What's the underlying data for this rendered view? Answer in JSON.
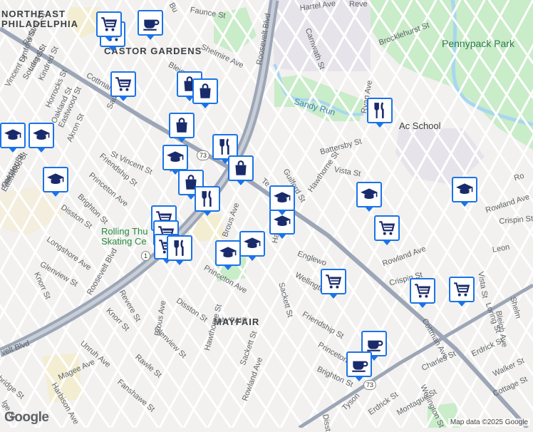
{
  "map": {
    "colors": {
      "land": "#f2f1ef",
      "park": "#c9ecc9",
      "water": "#a8d7f0",
      "highway": "#9ca6b6",
      "road": "#ffffff",
      "pin_border": "#1a73e8",
      "mall": "#f3edd2",
      "grey_zone": "#e6e4ea"
    },
    "area_labels": [
      {
        "id": "northeast",
        "text": "NORTHEAST"
      },
      {
        "id": "philadelphia",
        "text": "PHILADELPHIA"
      },
      {
        "id": "castor-gardens",
        "text": "CASTOR GARDENS"
      },
      {
        "id": "mayfair",
        "text": "MAYFAIR"
      }
    ],
    "park_labels": [
      {
        "id": "pennypack",
        "text": "Pennypack Park"
      }
    ],
    "water_labels": [
      {
        "id": "sandy-run",
        "text": "Sandy Run"
      }
    ],
    "poi_labels": [
      {
        "id": "rolling-1",
        "text": "Rolling Thu"
      },
      {
        "id": "rolling-2",
        "text": "Skating Ce"
      },
      {
        "id": "school",
        "text": "Ac     School"
      }
    ],
    "street_labels": [
      "Hartel Ave",
      "Reve",
      "Carnwath St",
      "Brocklehurst St",
      "Bu",
      "Faunce St",
      "Shelmire Ave",
      "Roosevelt Blvd",
      "Ryan Ave",
      "Battersby St",
      "Vista St",
      "Guilford St",
      "Hawthorne St",
      "Te",
      "Rowland Ave",
      "Rowland Ave",
      "Ro",
      "Crispin St",
      "Leon",
      "Crispin St",
      "Vista St",
      "Loring St",
      "Bleigh Ave",
      "Shelm",
      "Erdrick St",
      "Walker St",
      "Cottage St",
      "Cottman Ave",
      "Charles St",
      "Wellington St",
      "Montague St",
      "Erdrick St",
      "Tyson",
      "Disst",
      "Brighton St",
      "Princeton",
      "Friendship St",
      "Sackett St",
      "Wellington",
      "Englewo",
      "Hawthorne St",
      "Brous Ave",
      "Princeton Ave",
      "MAYFAIR",
      "Disston St",
      "Hawthorne St",
      "Sackett St",
      "Rowland Ave",
      "Glenview St",
      "Brous Ave",
      "Rawle St",
      "Fanshawe St",
      "Unruh Ave",
      "Knorr St",
      "Revere St",
      "Roosevelt Blvd",
      "Magee Ave",
      "Harbison Ave",
      "velt Blvd",
      "bridge St",
      "lge St",
      "Longshore Ave",
      "Glenview St",
      "Knorr St",
      "Disston St",
      "Brighton St",
      "Princeton Ave",
      "Friendship St",
      "St Vincent St",
      "Saul St",
      "Akron St",
      "Eastwood St",
      "Oakland St",
      "Horrocks St",
      "Kindred St",
      "Large St",
      "Souder St",
      "Lynford St",
      "Rutland St",
      "Vincent St",
      "Cottman Ave",
      "Oakland St",
      "Eastwood St",
      "veester St",
      "Bleig",
      "Ru"
    ],
    "route_shields": [
      "73",
      "73",
      "1"
    ],
    "pins": [
      {
        "name": "cafe",
        "icon": "coffee-icon"
      },
      {
        "name": "grocery",
        "icon": "shopping-cart-icon"
      },
      {
        "name": "grocery",
        "icon": "shopping-cart-icon"
      },
      {
        "name": "grocery",
        "icon": "shopping-cart-icon"
      },
      {
        "name": "shop",
        "icon": "shopping-bag-icon"
      },
      {
        "name": "shop",
        "icon": "shopping-bag-icon"
      },
      {
        "name": "school",
        "icon": "school-icon"
      },
      {
        "name": "school",
        "icon": "school-icon"
      },
      {
        "name": "school",
        "icon": "school-icon"
      },
      {
        "name": "shop",
        "icon": "shopping-bag-icon"
      },
      {
        "name": "restaurant",
        "icon": "fork-knife-icon"
      },
      {
        "name": "shop",
        "icon": "shopping-bag-icon"
      },
      {
        "name": "school",
        "icon": "school-icon"
      },
      {
        "name": "grocery",
        "icon": "shopping-cart-icon"
      },
      {
        "name": "shop",
        "icon": "shopping-bag-icon"
      },
      {
        "name": "restaurant",
        "icon": "fork-knife-icon"
      },
      {
        "name": "grocery",
        "icon": "shopping-cart-icon"
      },
      {
        "name": "grocery",
        "icon": "shopping-cart-icon"
      },
      {
        "name": "restaurant",
        "icon": "fork-knife-icon"
      },
      {
        "name": "school",
        "icon": "school-icon"
      },
      {
        "name": "school",
        "icon": "school-icon"
      },
      {
        "name": "school",
        "icon": "school-icon"
      },
      {
        "name": "school",
        "icon": "school-icon"
      },
      {
        "name": "school",
        "icon": "school-icon"
      },
      {
        "name": "school",
        "icon": "school-icon"
      },
      {
        "name": "restaurant",
        "icon": "fork-knife-icon"
      },
      {
        "name": "grocery",
        "icon": "shopping-cart-icon"
      },
      {
        "name": "grocery",
        "icon": "shopping-cart-icon"
      },
      {
        "name": "grocery",
        "icon": "shopping-cart-icon"
      },
      {
        "name": "grocery",
        "icon": "shopping-cart-icon"
      },
      {
        "name": "cafe",
        "icon": "coffee-icon"
      },
      {
        "name": "cafe",
        "icon": "coffee-icon"
      }
    ]
  },
  "footer": {
    "logo": "Google",
    "attribution": "Map data ©2025 Google"
  }
}
